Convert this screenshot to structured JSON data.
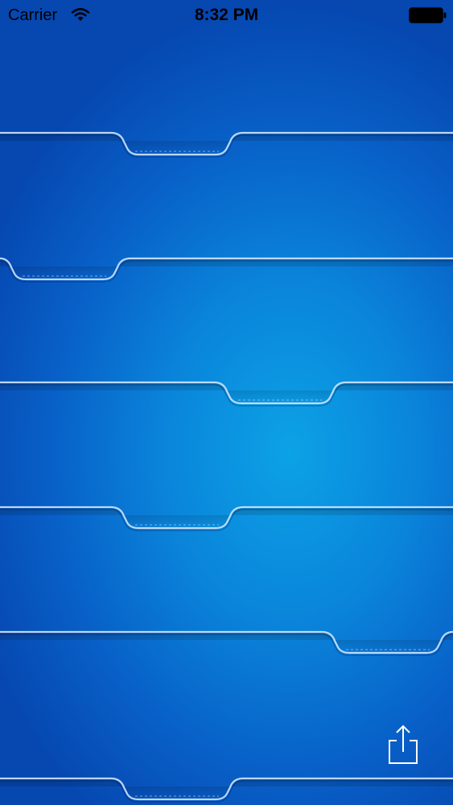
{
  "status_bar": {
    "carrier": "Carrier",
    "time": "8:32 PM",
    "wifi_icon": "wifi-icon",
    "battery_icon": "battery-icon"
  },
  "shelves": {
    "count": 6,
    "tab_positions": [
      "center",
      "left",
      "center-right",
      "center",
      "right",
      "center"
    ]
  },
  "toolbar": {
    "share_icon": "share-icon"
  },
  "colors": {
    "background_center": "#0ca2e6",
    "background_edge": "#0647b0",
    "shelf_line": "#cfe6ff",
    "icon": "#ffffff"
  }
}
